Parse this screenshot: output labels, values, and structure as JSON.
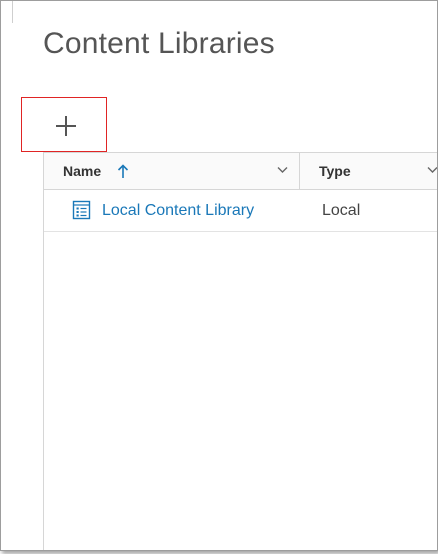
{
  "page": {
    "title": "Content Libraries"
  },
  "toolbar": {
    "add_icon": "plus-icon",
    "highlight_color": "#e02424"
  },
  "grid": {
    "columns": [
      {
        "label": "Name",
        "sorted": "ascending",
        "sort_icon": "arrow-up-icon",
        "menu_icon": "chevron-down-icon"
      },
      {
        "label": "Type",
        "menu_icon": "chevron-down-icon"
      }
    ],
    "rows": [
      {
        "name": "Local Content Library",
        "type": "Local",
        "icon": "library-icon"
      }
    ]
  },
  "colors": {
    "link": "#1a78b8",
    "title": "#555555",
    "border": "#d6d6d6"
  }
}
